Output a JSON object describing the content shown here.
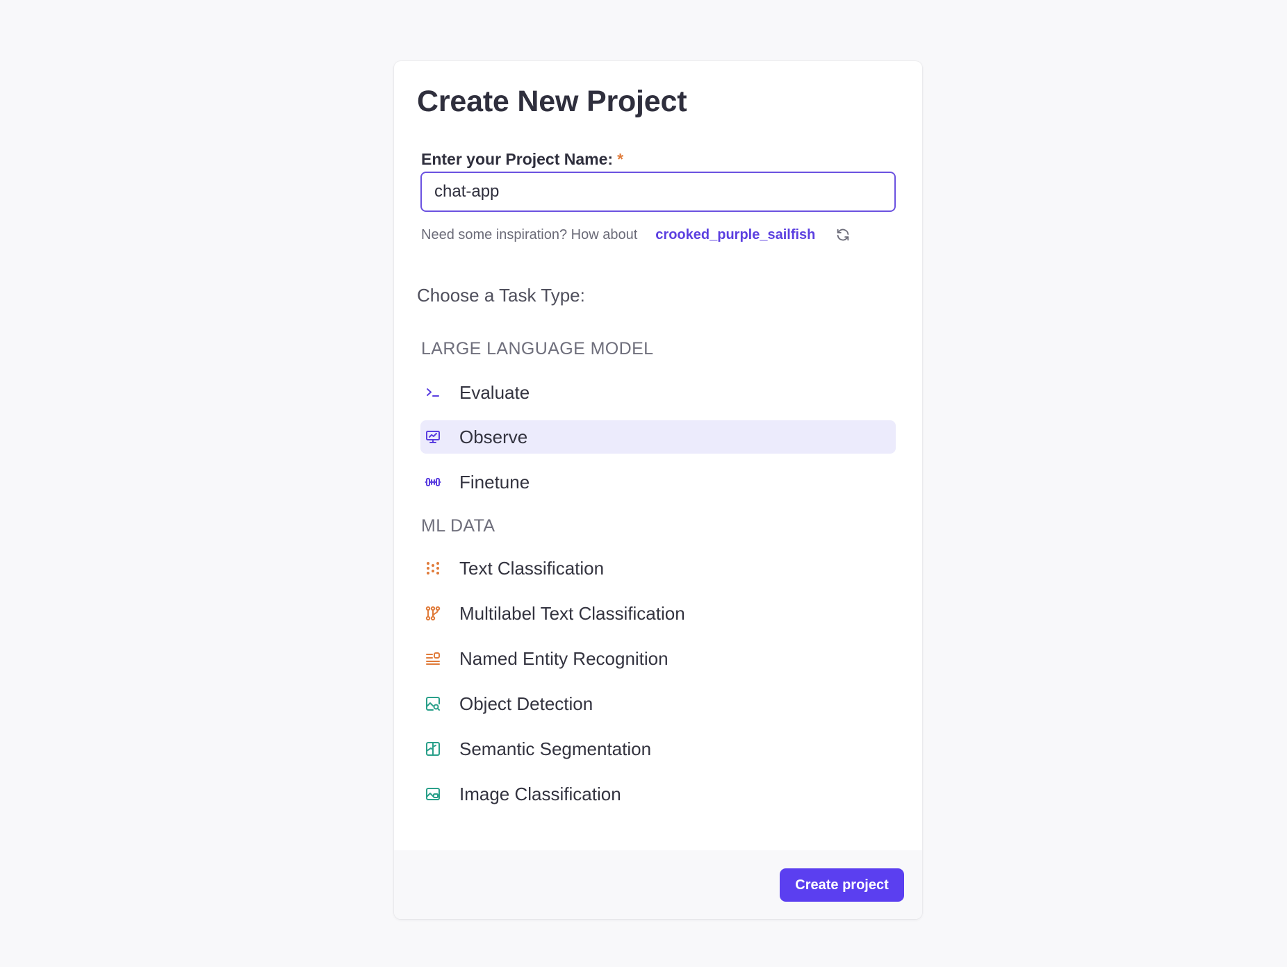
{
  "page": {
    "title": "Create New Project"
  },
  "project_name": {
    "label": "Enter your Project Name:",
    "required_marker": "*",
    "value": "chat-app"
  },
  "inspiration": {
    "prompt": "Need some inspiration? How about",
    "suggestion": "crooked_purple_sailfish",
    "refresh_icon": "refresh-icon"
  },
  "task_type": {
    "heading": "Choose a Task Type:",
    "selected": "Observe",
    "groups": [
      {
        "heading": "LARGE LANGUAGE MODEL",
        "items": [
          {
            "label": "Evaluate",
            "icon": "terminal-icon"
          },
          {
            "label": "Observe",
            "icon": "monitor-chart-icon"
          },
          {
            "label": "Finetune",
            "icon": "dumbbell-icon"
          }
        ]
      },
      {
        "heading": "ML DATA",
        "items": [
          {
            "label": "Text Classification",
            "icon": "dots-grid-icon"
          },
          {
            "label": "Multilabel Text Classification",
            "icon": "nodes-icon"
          },
          {
            "label": "Named Entity Recognition",
            "icon": "text-tag-icon"
          },
          {
            "label": "Object Detection",
            "icon": "image-search-icon"
          },
          {
            "label": "Semantic Segmentation",
            "icon": "segment-icon"
          },
          {
            "label": "Image Classification",
            "icon": "image-label-icon"
          }
        ]
      }
    ]
  },
  "footer": {
    "create_button": "Create project"
  },
  "colors": {
    "accent": "#5b3ff0",
    "selected_background": "#ecebfc",
    "required": "#e07b3a",
    "llm_icon": "#5b3fe0",
    "text_icon": "#e07b3a",
    "image_icon": "#2aa08a"
  }
}
